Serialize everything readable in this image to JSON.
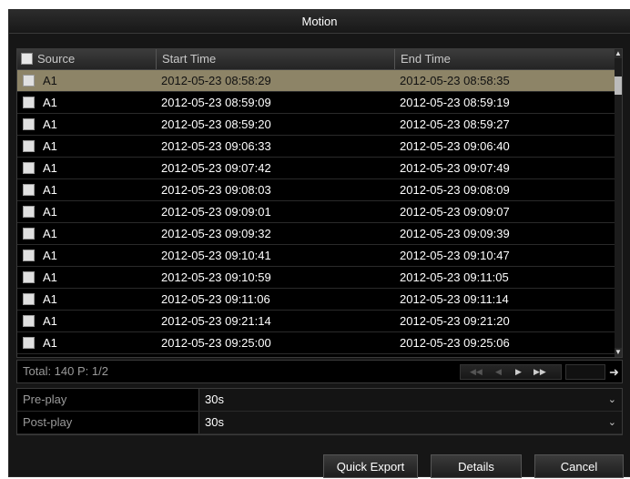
{
  "dialog": {
    "title": "Motion"
  },
  "table": {
    "headers": {
      "source": "Source",
      "start": "Start Time",
      "end": "End Time"
    },
    "rows": [
      {
        "source": "A1",
        "start": "2012-05-23 08:58:29",
        "end": "2012-05-23 08:58:35",
        "selected": true
      },
      {
        "source": "A1",
        "start": "2012-05-23 08:59:09",
        "end": "2012-05-23 08:59:19"
      },
      {
        "source": "A1",
        "start": "2012-05-23 08:59:20",
        "end": "2012-05-23 08:59:27"
      },
      {
        "source": "A1",
        "start": "2012-05-23 09:06:33",
        "end": "2012-05-23 09:06:40"
      },
      {
        "source": "A1",
        "start": "2012-05-23 09:07:42",
        "end": "2012-05-23 09:07:49"
      },
      {
        "source": "A1",
        "start": "2012-05-23 09:08:03",
        "end": "2012-05-23 09:08:09"
      },
      {
        "source": "A1",
        "start": "2012-05-23 09:09:01",
        "end": "2012-05-23 09:09:07"
      },
      {
        "source": "A1",
        "start": "2012-05-23 09:09:32",
        "end": "2012-05-23 09:09:39"
      },
      {
        "source": "A1",
        "start": "2012-05-23 09:10:41",
        "end": "2012-05-23 09:10:47"
      },
      {
        "source": "A1",
        "start": "2012-05-23 09:10:59",
        "end": "2012-05-23 09:11:05"
      },
      {
        "source": "A1",
        "start": "2012-05-23 09:11:06",
        "end": "2012-05-23 09:11:14"
      },
      {
        "source": "A1",
        "start": "2012-05-23 09:21:14",
        "end": "2012-05-23 09:21:20"
      },
      {
        "source": "A1",
        "start": "2012-05-23 09:25:00",
        "end": "2012-05-23 09:25:06"
      }
    ]
  },
  "pager": {
    "total": "Total: 140  P: 1/2"
  },
  "settings": {
    "preplay": {
      "label": "Pre-play",
      "value": "30s"
    },
    "postplay": {
      "label": "Post-play",
      "value": "30s"
    }
  },
  "buttons": {
    "quick_export": "Quick Export",
    "details": "Details",
    "cancel": "Cancel"
  }
}
